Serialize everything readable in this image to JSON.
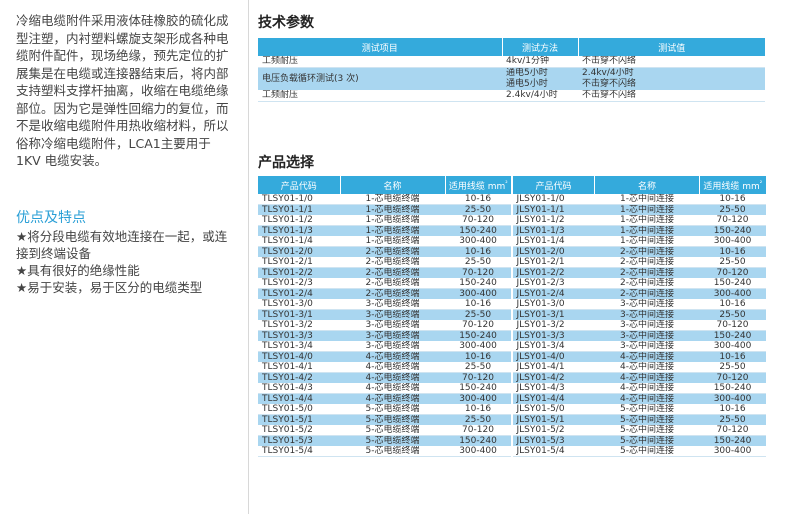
{
  "intro": {
    "lines": [
      "冷缩电缆附件采用液体硅橡胶的硫化成",
      "型注塑，内衬塑料螺旋支架形成各种电",
      "缆附件配件，现场绝缘，预先定位的扩",
      "展集是在电缆或连接器结束后，将内部",
      "支持塑料支撑杆抽离，收缩在电缆绝缘",
      "部位。因为它是弹性回缩力的复位，而",
      "不是收缩电缆附件用热收缩材料，所以",
      "俗称冷缩电缆附件，LCA1主要用于",
      "1KV 电缆安装。"
    ]
  },
  "advantages": {
    "title": "优点及特点",
    "items": [
      "★将分段电缆有效地连接在一起，或连",
      "接到终端设备",
      "★具有很好的绝缘性能",
      "★易于安装，易于区分的电缆类型"
    ]
  },
  "tech": {
    "title": "技术参数",
    "headers": [
      "测试项目",
      "测试方法",
      "测试值"
    ],
    "row1": [
      "工频耐压",
      "4kv/1分钟",
      "不击穿不闪络"
    ],
    "row2_item": "电压负载循环测试(3 次)",
    "row2_methods": [
      "通电5小时",
      "通电5小时"
    ],
    "row2_values": [
      "2.4kv/4小时",
      "不击穿不闪络"
    ],
    "row3": [
      "工频耐压",
      "2.4kv/4小时",
      "不击穿不闪络"
    ]
  },
  "products": {
    "title": "产品选择",
    "headers": [
      "产品代码",
      "名称",
      "适用线缆 mm",
      "²"
    ],
    "left": [
      [
        "TLSY01-1/0",
        "1-芯电缆终端",
        "10-16"
      ],
      [
        "TLSY01-1/1",
        "1-芯电缆终端",
        "25-50"
      ],
      [
        "TLSY01-1/2",
        "1-芯电缆终端",
        "70-120"
      ],
      [
        "TLSY01-1/3",
        "1-芯电缆终端",
        "150-240"
      ],
      [
        "TLSY01-1/4",
        "1-芯电缆终端",
        "300-400"
      ],
      [
        "TLSY01-2/0",
        "2-芯电缆终端",
        "10-16"
      ],
      [
        "TLSY01-2/1",
        "2-芯电缆终端",
        "25-50"
      ],
      [
        "TLSY01-2/2",
        "2-芯电缆终端",
        "70-120"
      ],
      [
        "TLSY01-2/3",
        "2-芯电缆终端",
        "150-240"
      ],
      [
        "TLSY01-2/4",
        "2-芯电缆终端",
        "300-400"
      ],
      [
        "TLSY01-3/0",
        "3-芯电缆终端",
        "10-16"
      ],
      [
        "TLSY01-3/1",
        "3-芯电缆终端",
        "25-50"
      ],
      [
        "TLSY01-3/2",
        "3-芯电缆终端",
        "70-120"
      ],
      [
        "TLSY01-3/3",
        "3-芯电缆终端",
        "150-240"
      ],
      [
        "TLSY01-3/4",
        "3-芯电缆终端",
        "300-400"
      ],
      [
        "TLSY01-4/0",
        "4-芯电缆终端",
        "10-16"
      ],
      [
        "TLSY01-4/1",
        "4-芯电缆终端",
        "25-50"
      ],
      [
        "TLSY01-4/2",
        "4-芯电缆终端",
        "70-120"
      ],
      [
        "TLSY01-4/3",
        "4-芯电缆终端",
        "150-240"
      ],
      [
        "TLSY01-4/4",
        "4-芯电缆终端",
        "300-400"
      ],
      [
        "TLSY01-5/0",
        "5-芯电缆终端",
        "10-16"
      ],
      [
        "TLSY01-5/1",
        "5-芯电缆终端",
        "25-50"
      ],
      [
        "TLSY01-5/2",
        "5-芯电缆终端",
        "70-120"
      ],
      [
        "TLSY01-5/3",
        "5-芯电缆终端",
        "150-240"
      ],
      [
        "TLSY01-5/4",
        "5-芯电缆终端",
        "300-400"
      ]
    ],
    "right": [
      [
        "JLSY01-1/0",
        "1-芯中间连接",
        "10-16"
      ],
      [
        "JLSY01-1/1",
        "1-芯中间连接",
        "25-50"
      ],
      [
        "JLSY01-1/2",
        "1-芯中间连接",
        "70-120"
      ],
      [
        "JLSY01-1/3",
        "1-芯中间连接",
        "150-240"
      ],
      [
        "JLSY01-1/4",
        "1-芯中间连接",
        "300-400"
      ],
      [
        "JLSY01-2/0",
        "2-芯中间连接",
        "10-16"
      ],
      [
        "JLSY01-2/1",
        "2-芯中间连接",
        "25-50"
      ],
      [
        "JLSY01-2/2",
        "2-芯中间连接",
        "70-120"
      ],
      [
        "JLSY01-2/3",
        "2-芯中间连接",
        "150-240"
      ],
      [
        "JLSY01-2/4",
        "2-芯中间连接",
        "300-400"
      ],
      [
        "JLSY01-3/0",
        "3-芯中间连接",
        "10-16"
      ],
      [
        "JLSY01-3/1",
        "3-芯中间连接",
        "25-50"
      ],
      [
        "JLSY01-3/2",
        "3-芯中间连接",
        "70-120"
      ],
      [
        "JLSY01-3/3",
        "3-芯中间连接",
        "150-240"
      ],
      [
        "JLSY01-3/4",
        "3-芯中间连接",
        "300-400"
      ],
      [
        "JLSY01-4/0",
        "4-芯中间连接",
        "10-16"
      ],
      [
        "JLSY01-4/1",
        "4-芯中间连接",
        "25-50"
      ],
      [
        "JLSY01-4/2",
        "4-芯中间连接",
        "70-120"
      ],
      [
        "JLSY01-4/3",
        "4-芯中间连接",
        "150-240"
      ],
      [
        "JLSY01-4/4",
        "4-芯中间连接",
        "300-400"
      ],
      [
        "JLSY01-5/0",
        "5-芯中间连接",
        "10-16"
      ],
      [
        "JLSY01-5/1",
        "5-芯中间连接",
        "25-50"
      ],
      [
        "JLSY01-5/2",
        "5-芯中间连接",
        "70-120"
      ],
      [
        "JLSY01-5/3",
        "5-芯中间连接",
        "150-240"
      ],
      [
        "JLSY01-5/4",
        "5-芯中间连接",
        "300-400"
      ]
    ]
  },
  "colors": {
    "header": "#34aadc",
    "stripe": "#a9d6f0",
    "accent": "#2a9fd6"
  }
}
